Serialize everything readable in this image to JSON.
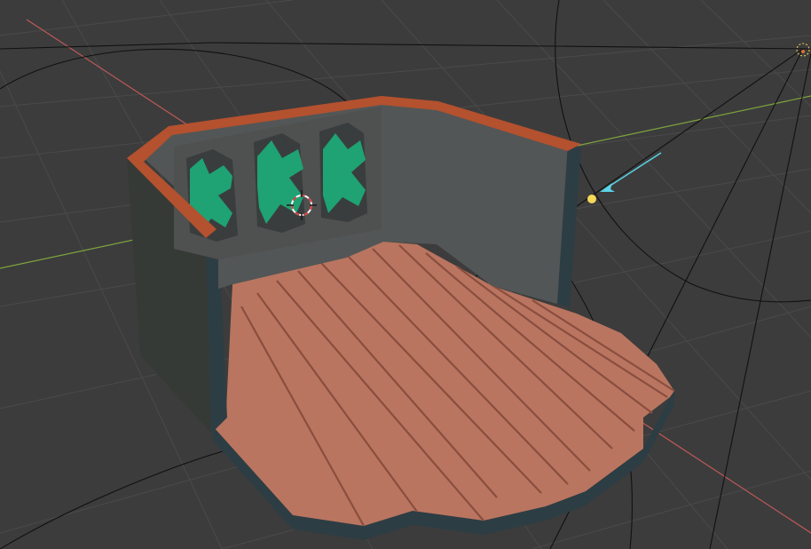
{
  "viewport": {
    "background_color": "#3c3c3c",
    "grid_color": "#4a4a4a",
    "x_axis_color": "#c05858",
    "y_axis_color": "#7ea43c"
  },
  "scene": {
    "floor_top_color": "#b97560",
    "floor_plank_line_color": "#8a4e3e",
    "floor_side_color": "#2d3d44",
    "wall_inner_color": "#535656",
    "wall_outer_color": "#363a36",
    "wall_trim_color": "#b4512e",
    "window_frame_color": "#4f5050",
    "gear_color": "#1fa274"
  },
  "gizmos": {
    "light_color": "#f5d858",
    "light_direction_color": "#5ad4e6",
    "camera_wire_color": "#111111",
    "cursor_icon": "3d-cursor-icon",
    "light_icon": "sun-light-icon",
    "camera_icon": "camera-icon"
  }
}
